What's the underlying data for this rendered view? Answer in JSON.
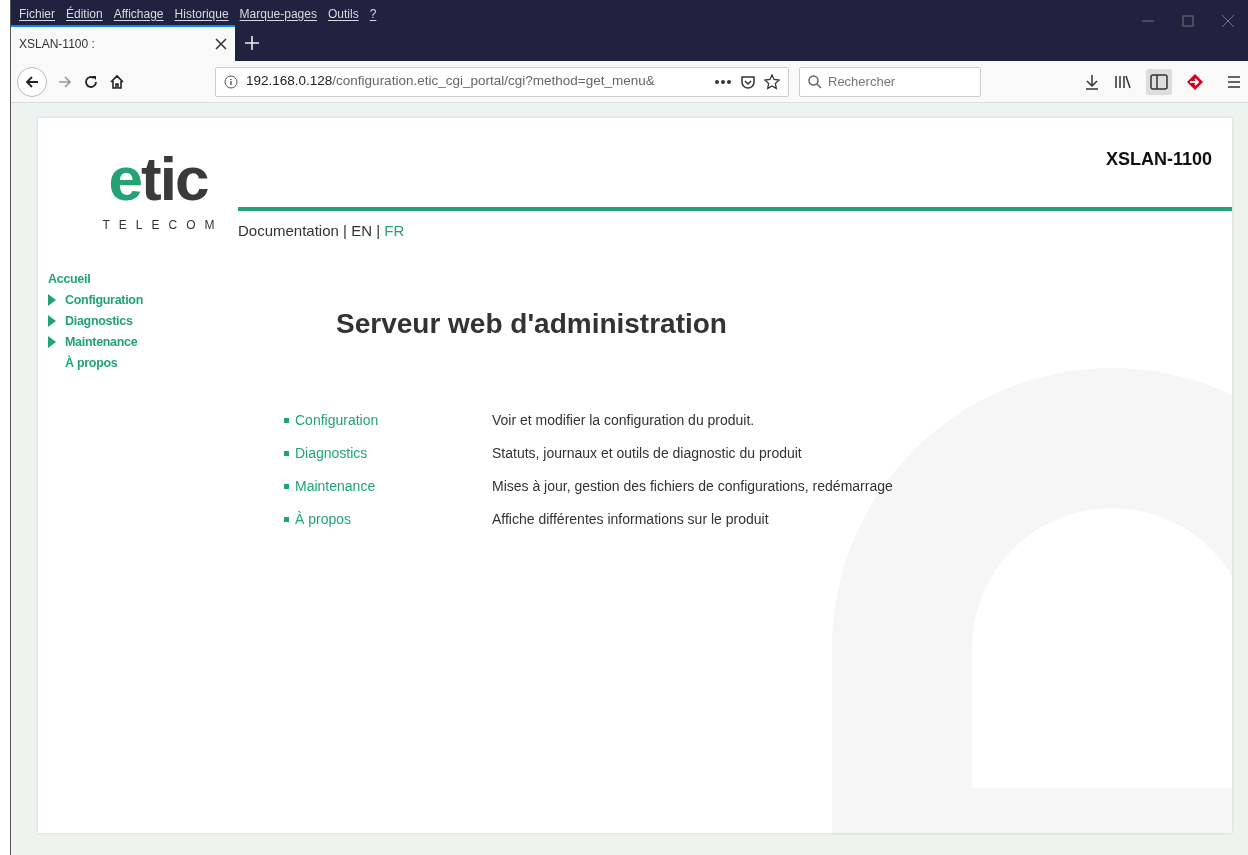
{
  "browser": {
    "menu": [
      "Fichier",
      "Édition",
      "Affichage",
      "Historique",
      "Marque-pages",
      "Outils",
      "?"
    ],
    "tabs": [
      {
        "label": "XSLAN-1100 :",
        "selected": true
      }
    ],
    "address": {
      "host": "192.168.0.128",
      "path": "/configuration.etic_cgi_portal/cgi?method=get_menu&"
    },
    "search": {
      "placeholder": "Rechercher"
    }
  },
  "page": {
    "logo": {
      "mark_accent": "e",
      "mark_rest": "tic",
      "subtitle": "TELECOM"
    },
    "product": "XSLAN-1100",
    "link_separators": [
      "|",
      "|"
    ],
    "links": [
      {
        "label": "Documentation",
        "selected": false
      },
      {
        "label": "EN",
        "selected": false
      },
      {
        "label": "FR",
        "selected": true
      }
    ],
    "sidebar": {
      "items": [
        {
          "label": "Accueil",
          "expandable": false
        },
        {
          "label": "Configuration",
          "expandable": true
        },
        {
          "label": "Diagnostics",
          "expandable": true
        },
        {
          "label": "Maintenance",
          "expandable": true
        },
        {
          "label": "À propos",
          "expandable": false
        }
      ]
    },
    "title": "Serveur web d'administration",
    "sections": [
      {
        "label": "Configuration",
        "description": "Voir et modifier la configuration du produit."
      },
      {
        "label": "Diagnostics",
        "description": "Statuts, journaux et outils de diagnostic du produit"
      },
      {
        "label": "Maintenance",
        "description": "Mises à jour, gestion des fichiers de configurations, redémarrage"
      },
      {
        "label": "À propos",
        "description": "Affiche différentes informations sur le produit"
      }
    ]
  }
}
